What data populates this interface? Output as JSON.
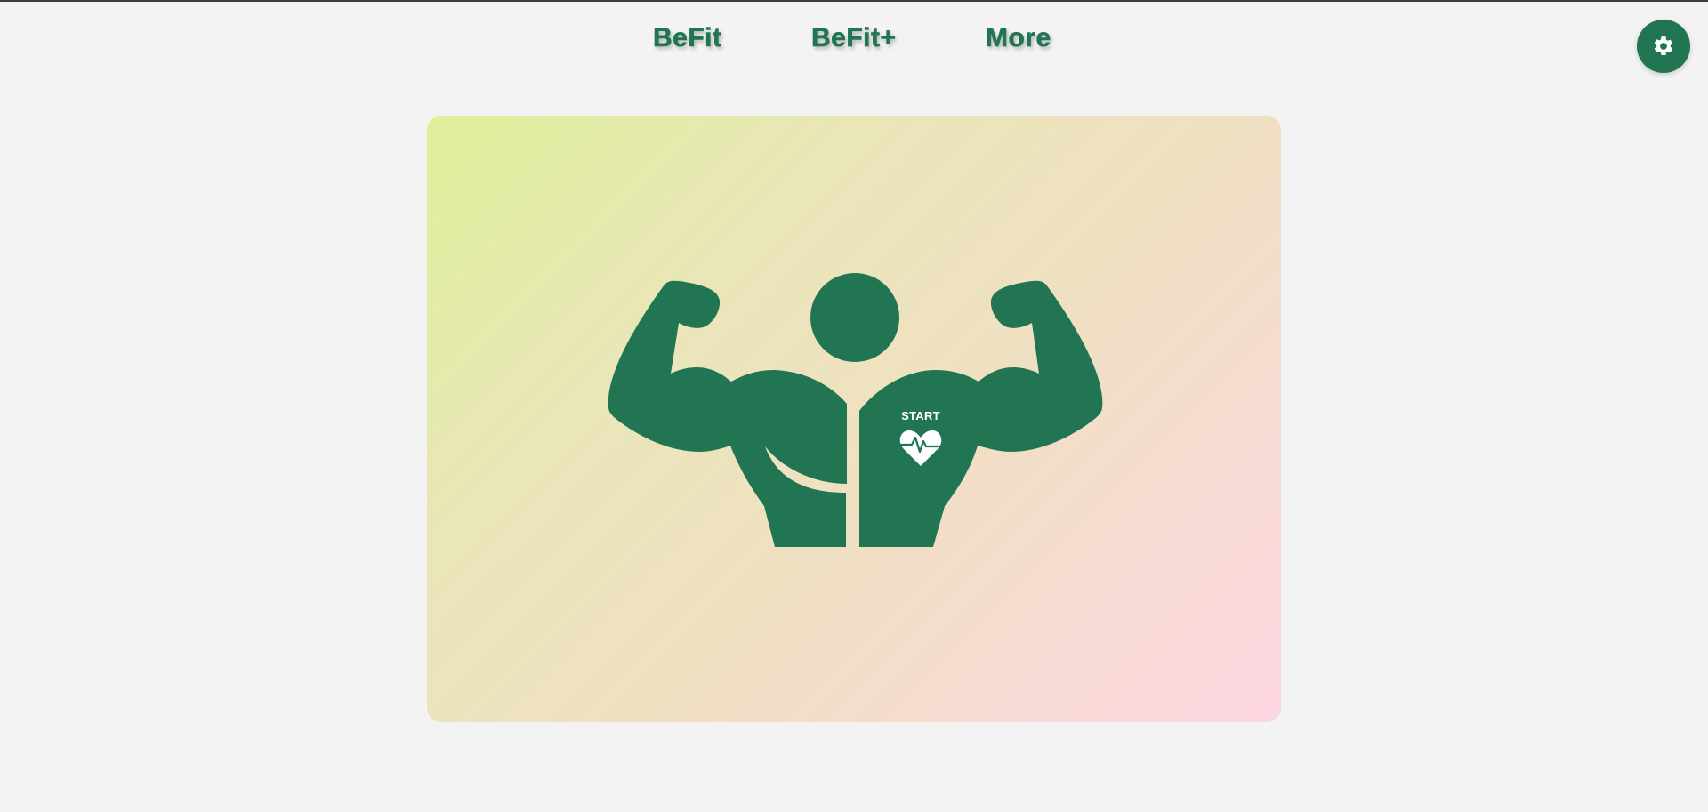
{
  "nav": {
    "items": [
      {
        "label": "BeFit"
      },
      {
        "label": "BeFit+"
      },
      {
        "label": "More"
      }
    ]
  },
  "settings": {
    "icon": "gear-icon"
  },
  "hero": {
    "figure_icon": "flexing-muscle-figure",
    "start_label": "START",
    "start_icon": "heart-pulse-icon"
  },
  "colors": {
    "brand_green": "#217553",
    "page_background": "#f3f3f3",
    "gradient_start": "#dff09a",
    "gradient_end": "#fcd6e2"
  }
}
